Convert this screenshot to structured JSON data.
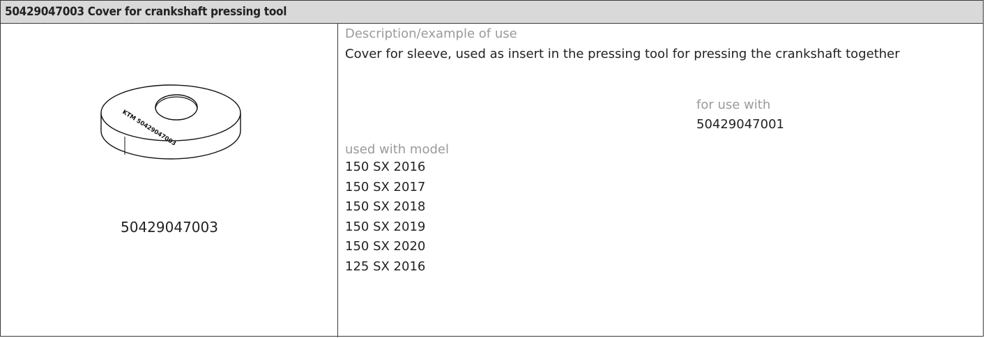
{
  "header": {
    "title": "50429047003 Cover for crankshaft pressing tool"
  },
  "tool": {
    "image_label": "50429047003",
    "engraving": "KTM 50429047003",
    "description_label": "Description/example of use",
    "description_text": "Cover for sleeve, used as insert in the pressing tool for pressing the crankshaft together",
    "for_use_with_label": "for use with",
    "for_use_with_value": "50429047001",
    "used_with_model_label": "used with model",
    "models": [
      "150 SX 2016",
      "150 SX 2017",
      "150 SX 2018",
      "150 SX 2019",
      "150 SX 2020",
      "125 SX 2016"
    ]
  },
  "colors": {
    "header_bg": "#d9d9d9",
    "border": "#3a3a3a",
    "muted_text": "#9a9a9a"
  }
}
